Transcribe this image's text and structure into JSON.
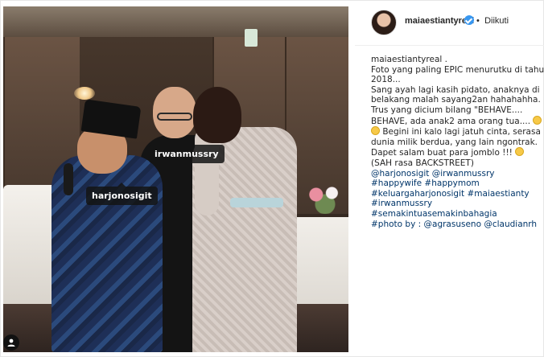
{
  "header": {
    "username": "maiaestiantyreal",
    "verified_icon": "verified-badge-icon",
    "dot": "•",
    "follow_state": "Diikuti"
  },
  "photo_tags": {
    "tag1": "irwanmussry",
    "tag2": "harjonosigit"
  },
  "caption": {
    "author": "maiaestiantyreal",
    "lines": [
      "maiaestiantyreal .",
      "Foto yang paling EPIC menurutku di tahun",
      "2018...",
      "Sang ayah lagi kasih pidato, anaknya di",
      "belakang malah sayang2an hahahahha.",
      "Trus yang dicium bilang \"BEHAVE....",
      "BEHAVE, ada anak2 ama orang tua....",
      " Begini ini kalo lagi jatuh cinta, serasa",
      "dunia milik berdua, yang lain ngontrak.",
      "Dapet salam buat para jomblo !!!",
      "(SAH rasa BACKSTREET)",
      "@harjonosigit @irwanmussry",
      "#happywife #happymom",
      "#keluargaharjonosigit #maiaestianty",
      "#irwanmussry",
      "#semakintuasemakinbahagia",
      "#photo by : @agrasuseno @claudianrh"
    ]
  },
  "icons": {
    "user_tag": "user-tag-icon",
    "emoji": "grinning-face-emoji"
  },
  "colors": {
    "link": "#003569",
    "verified": "#3897f0",
    "text": "#262626"
  }
}
